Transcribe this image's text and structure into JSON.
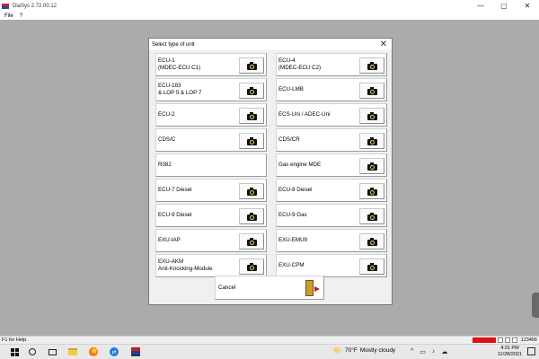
{
  "window": {
    "title": "DiaSys 2.72.00.12",
    "minimize_glyph": "—",
    "maximize_glyph": "▢",
    "close_glyph": "✕"
  },
  "menu": [
    "File",
    "?"
  ],
  "dialog": {
    "title": "Select type of unit",
    "close_glyph": "✕",
    "units": [
      {
        "label": "ECU-1\n(MDEC-ECU C1)",
        "icon": "camera-icon"
      },
      {
        "label": "ECU-4\n(MDEC-ECU C2)",
        "icon": "camera-icon"
      },
      {
        "label": "ECU-183\n& LOP 5 & LOP 7",
        "icon": "camera-icon"
      },
      {
        "label": "ECU-LMB",
        "icon": "camera-icon"
      },
      {
        "label": "ECU-2",
        "icon": "camera-icon"
      },
      {
        "label": "ECS-Uni / ADEC-Uni",
        "icon": "camera-icon"
      },
      {
        "label": "CDS/C",
        "icon": "camera-icon"
      },
      {
        "label": "CDS/CR",
        "icon": "camera-icon"
      },
      {
        "label": "R082",
        "icon": null
      },
      {
        "label": "Gas engine MDE",
        "icon": "camera-icon"
      },
      {
        "label": "ECU-7 Diesel",
        "icon": "camera-icon"
      },
      {
        "label": "ECU-8 Diesel",
        "icon": "camera-icon"
      },
      {
        "label": "ECU-9 Diesel",
        "icon": "camera-icon"
      },
      {
        "label": "ECU-9 Gas",
        "icon": "camera-icon"
      },
      {
        "label": "EXU-IAP",
        "icon": "camera-icon"
      },
      {
        "label": "EXU-EMU9",
        "icon": "camera-icon"
      },
      {
        "label": "EXU-AKM\nAnti-Knocking-Module",
        "icon": "camera-icon"
      },
      {
        "label": "EXU-CPM",
        "icon": "camera-icon"
      }
    ],
    "cancel_label": "Cancel"
  },
  "status": {
    "help": "F1 for Help.",
    "number": "123456",
    "indicator_color": "#e01010"
  },
  "taskbar": {
    "weather_temp": "70°F",
    "weather_text": "Mostly cloudy",
    "time": "4:31 PM",
    "date": "11/28/2021",
    "tray_glyphs": [
      "^",
      "▭",
      "♪",
      "☁"
    ]
  }
}
